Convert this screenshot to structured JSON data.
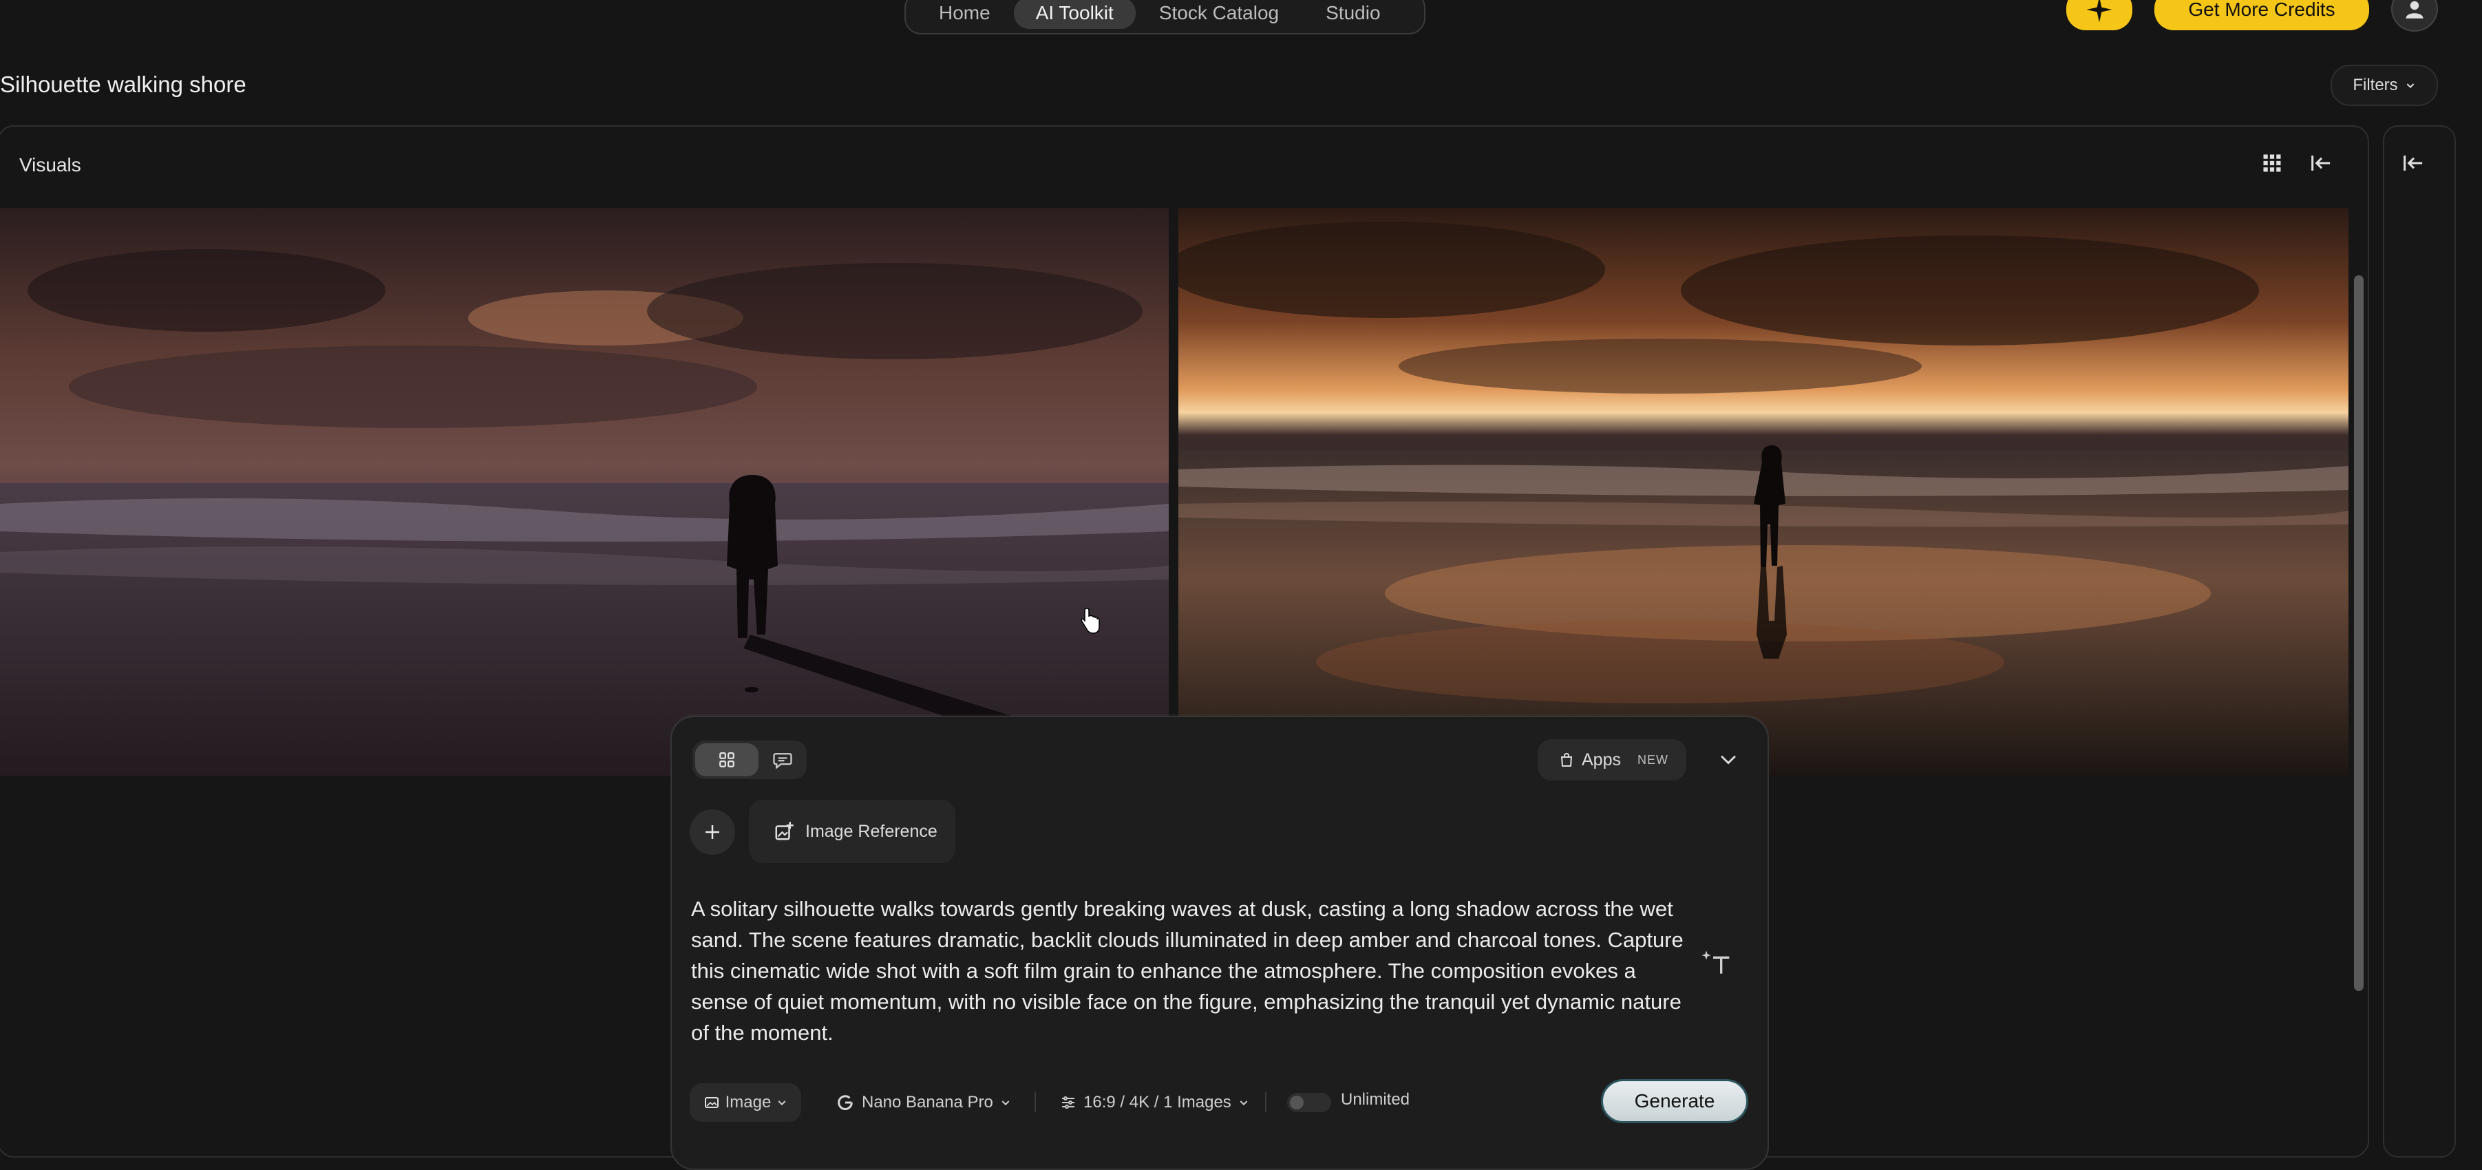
{
  "nav": {
    "tabs": [
      {
        "label": "Home",
        "active": false
      },
      {
        "label": "AI Toolkit",
        "active": true
      },
      {
        "label": "Stock Catalog",
        "active": false
      },
      {
        "label": "Studio",
        "active": false
      }
    ],
    "credits_label": "Get More Credits",
    "accent_color": "#f5c518"
  },
  "header": {
    "title": "Silhouette walking shore",
    "filters_label": "Filters"
  },
  "panel": {
    "label": "Visuals"
  },
  "composer": {
    "apps_label": "Apps",
    "apps_badge": "NEW",
    "image_reference_label": "Image Reference",
    "prompt": "A solitary silhouette walks towards gently breaking waves at dusk, casting a long shadow across the wet sand. The scene features dramatic, backlit clouds illuminated in deep amber and charcoal tones. Capture this cinematic wide shot with a soft film grain to enhance the atmosphere. The composition evokes a sense of quiet momentum, with no visible face on the figure, emphasizing the tranquil yet dynamic nature of the moment.",
    "type_label": "Image",
    "model_label": "Nano Banana Pro",
    "settings_label": "16:9 / 4K / 1 Images",
    "unlimited_label": "Unlimited",
    "unlimited_on": false,
    "generate_label": "Generate"
  }
}
